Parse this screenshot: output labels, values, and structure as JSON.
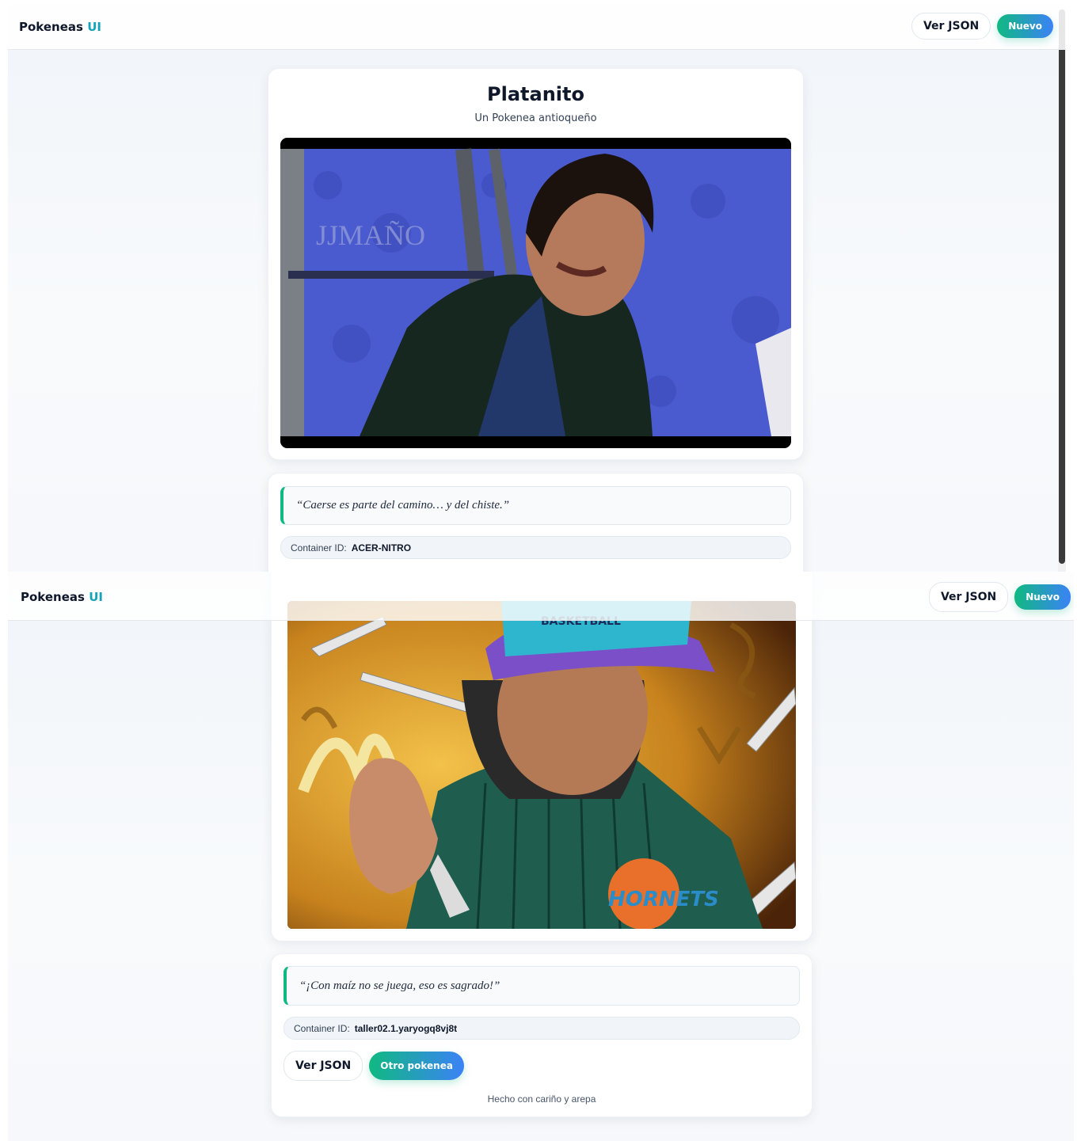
{
  "nav": {
    "brand": "Pokeneas",
    "brand_accent": "UI",
    "json_button": "Ver JSON",
    "new_button": "Nuevo"
  },
  "view1": {
    "name": "Platanito",
    "subtitle": "Un Pokenea antioqueño",
    "photo_watermark": "JJMAÑO",
    "quote": "“Caerse es parte del camino… y del chiste.”",
    "container_label": "Container ID:",
    "container_id": "ACER-NITRO"
  },
  "view2": {
    "photo_cap_text": "BASKETBALL",
    "photo_jacket_text": "HORNETS",
    "quote": "“¡Con maíz no se juega, eso es sagrado!”",
    "container_label": "Container ID:",
    "container_id": "taller02.1.yaryogq8vj8t",
    "json_button": "Ver JSON",
    "other_button": "Otro pokenea",
    "footer": "Hecho con cariño y arepa"
  },
  "colors": {
    "accent_green": "#10b981",
    "accent_blue": "#3b82f6",
    "brand_accent": "#14a3b8"
  }
}
